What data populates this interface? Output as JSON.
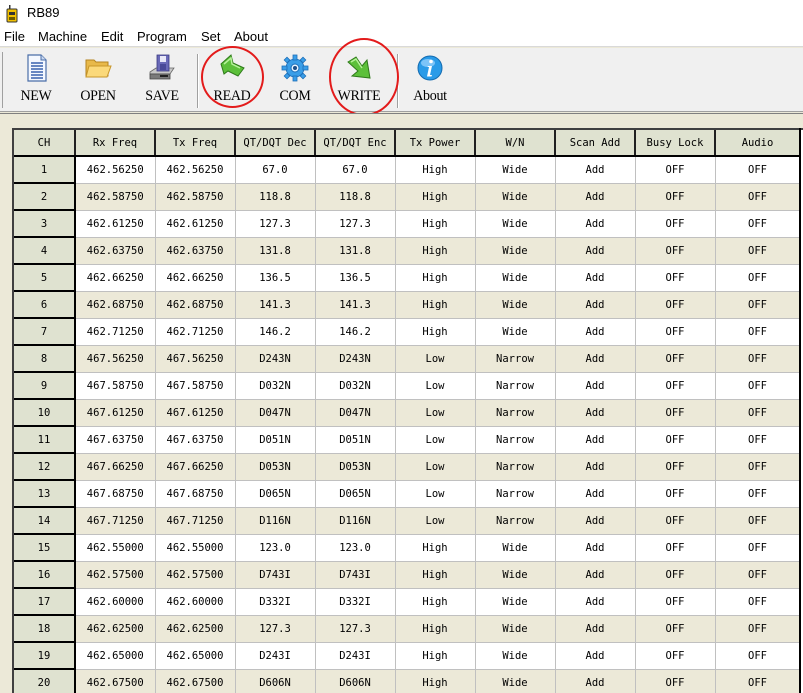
{
  "window": {
    "title": "RB89",
    "icon": "radio-icon"
  },
  "menu": [
    "File",
    "Machine",
    "Edit",
    "Program",
    "Set",
    "About"
  ],
  "toolbar": {
    "buttons": [
      {
        "label": "NEW",
        "icon": "new-document-icon"
      },
      {
        "label": "OPEN",
        "icon": "open-folder-icon"
      },
      {
        "label": "SAVE",
        "icon": "save-disk-icon"
      },
      {
        "label": "READ",
        "icon": "read-arrow-up-icon",
        "highlighted": true
      },
      {
        "label": "COM",
        "icon": "com-gear-icon"
      },
      {
        "label": "WRITE",
        "icon": "write-arrow-down-icon",
        "highlighted": true
      },
      {
        "label": "About",
        "icon": "info-icon"
      }
    ],
    "highlight_color": "#e31b1b"
  },
  "grid": {
    "columns": [
      "CH",
      "Rx Freq",
      "Tx Freq",
      "QT/DQT Dec",
      "QT/DQT Enc",
      "Tx Power",
      "W/N",
      "Scan Add",
      "Busy Lock",
      "Audio"
    ],
    "rows": [
      [
        "1",
        "462.56250",
        "462.56250",
        "67.0",
        "67.0",
        "High",
        "Wide",
        "Add",
        "OFF",
        "OFF"
      ],
      [
        "2",
        "462.58750",
        "462.58750",
        "118.8",
        "118.8",
        "High",
        "Wide",
        "Add",
        "OFF",
        "OFF"
      ],
      [
        "3",
        "462.61250",
        "462.61250",
        "127.3",
        "127.3",
        "High",
        "Wide",
        "Add",
        "OFF",
        "OFF"
      ],
      [
        "4",
        "462.63750",
        "462.63750",
        "131.8",
        "131.8",
        "High",
        "Wide",
        "Add",
        "OFF",
        "OFF"
      ],
      [
        "5",
        "462.66250",
        "462.66250",
        "136.5",
        "136.5",
        "High",
        "Wide",
        "Add",
        "OFF",
        "OFF"
      ],
      [
        "6",
        "462.68750",
        "462.68750",
        "141.3",
        "141.3",
        "High",
        "Wide",
        "Add",
        "OFF",
        "OFF"
      ],
      [
        "7",
        "462.71250",
        "462.71250",
        "146.2",
        "146.2",
        "High",
        "Wide",
        "Add",
        "OFF",
        "OFF"
      ],
      [
        "8",
        "467.56250",
        "467.56250",
        "D243N",
        "D243N",
        "Low",
        "Narrow",
        "Add",
        "OFF",
        "OFF"
      ],
      [
        "9",
        "467.58750",
        "467.58750",
        "D032N",
        "D032N",
        "Low",
        "Narrow",
        "Add",
        "OFF",
        "OFF"
      ],
      [
        "10",
        "467.61250",
        "467.61250",
        "D047N",
        "D047N",
        "Low",
        "Narrow",
        "Add",
        "OFF",
        "OFF"
      ],
      [
        "11",
        "467.63750",
        "467.63750",
        "D051N",
        "D051N",
        "Low",
        "Narrow",
        "Add",
        "OFF",
        "OFF"
      ],
      [
        "12",
        "467.66250",
        "467.66250",
        "D053N",
        "D053N",
        "Low",
        "Narrow",
        "Add",
        "OFF",
        "OFF"
      ],
      [
        "13",
        "467.68750",
        "467.68750",
        "D065N",
        "D065N",
        "Low",
        "Narrow",
        "Add",
        "OFF",
        "OFF"
      ],
      [
        "14",
        "467.71250",
        "467.71250",
        "D116N",
        "D116N",
        "Low",
        "Narrow",
        "Add",
        "OFF",
        "OFF"
      ],
      [
        "15",
        "462.55000",
        "462.55000",
        "123.0",
        "123.0",
        "High",
        "Wide",
        "Add",
        "OFF",
        "OFF"
      ],
      [
        "16",
        "462.57500",
        "462.57500",
        "D743I",
        "D743I",
        "High",
        "Wide",
        "Add",
        "OFF",
        "OFF"
      ],
      [
        "17",
        "462.60000",
        "462.60000",
        "D332I",
        "D332I",
        "High",
        "Wide",
        "Add",
        "OFF",
        "OFF"
      ],
      [
        "18",
        "462.62500",
        "462.62500",
        "127.3",
        "127.3",
        "High",
        "Wide",
        "Add",
        "OFF",
        "OFF"
      ],
      [
        "19",
        "462.65000",
        "462.65000",
        "D243I",
        "D243I",
        "High",
        "Wide",
        "Add",
        "OFF",
        "OFF"
      ],
      [
        "20",
        "462.67500",
        "462.67500",
        "D606N",
        "D606N",
        "High",
        "Wide",
        "Add",
        "OFF",
        "OFF"
      ]
    ]
  }
}
